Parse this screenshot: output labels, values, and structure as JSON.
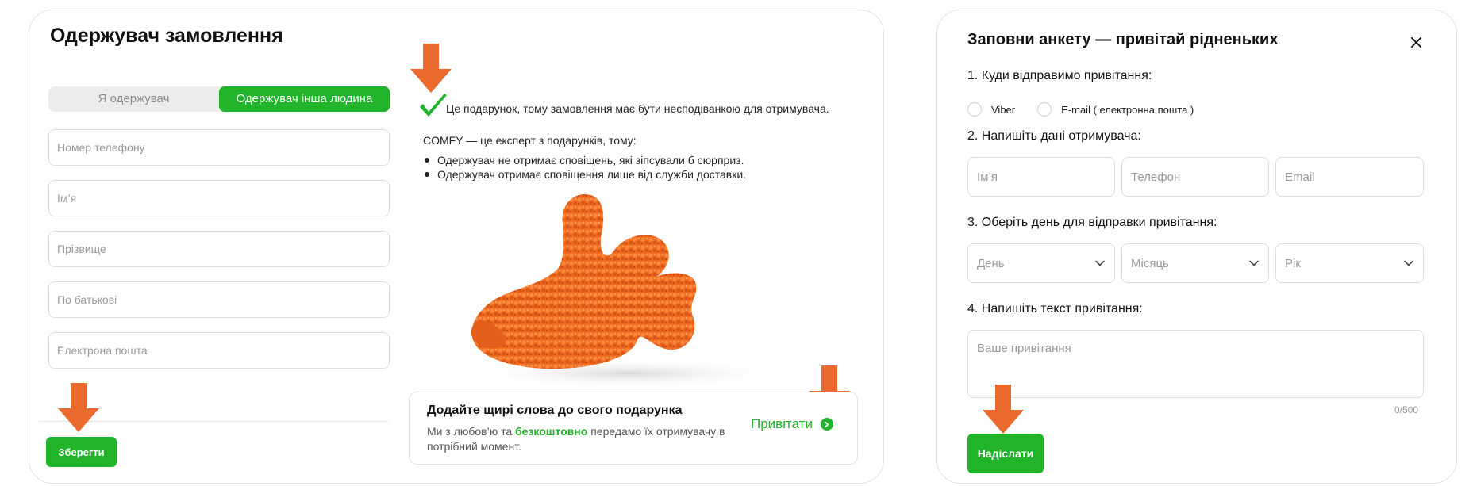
{
  "left": {
    "title": "Одержувач замовлення",
    "segment": {
      "option1": "Я одержувач",
      "option2": "Одержувач інша людина",
      "active": "Одержувач інша людина"
    },
    "fields": [
      {
        "placeholder": "Номер телефону"
      },
      {
        "placeholder": "Ім’я"
      },
      {
        "placeholder": "Прізвище"
      },
      {
        "placeholder": "По батькові"
      },
      {
        "placeholder": "Електрона пошта"
      }
    ],
    "save_label": "Зберегти",
    "gift_note": "Це подарунок, тому замовлення має бути несподіванкою для отримувача.",
    "expert_line": "COMFY — це експерт з подарунків, тому:",
    "bullets": [
      "Одержувач не отримає сповіщень, які зіпсували б сюрприз.",
      "Одержувач отримає сповіщення лише від служби доставки."
    ],
    "promo": {
      "title": "Додайте щирі слова до свого подарунка",
      "text_before": "Ми з любов’ю та ",
      "text_bold": "безкоштовно",
      "text_after": " передамо їх отримувачу в потрібний момент.",
      "link_label": "Привітати"
    }
  },
  "right": {
    "title": "Заповни анкету — привітай рідненьких",
    "q1": "1. Куди відправимо привітання:",
    "radio_options": [
      "Viber",
      "E-mail ( електронна пошта )"
    ],
    "q2": "2. Напишіть дані отримувача:",
    "recipient_fields": [
      "Ім’я",
      "Телефон",
      "Email"
    ],
    "q3": "3. Оберіть день для відправки привітання:",
    "date_selects": [
      "День",
      "Місяць",
      "Рік"
    ],
    "q4": "4. Напишіть текст привітання:",
    "message_placeholder": "Ваше привітання",
    "counter": "0/500",
    "send_label": "Надіслати"
  },
  "colors": {
    "accent_green": "#21b42a",
    "arrow_orange": "#ea6a2e",
    "plush_orange": "#f06a1c"
  }
}
